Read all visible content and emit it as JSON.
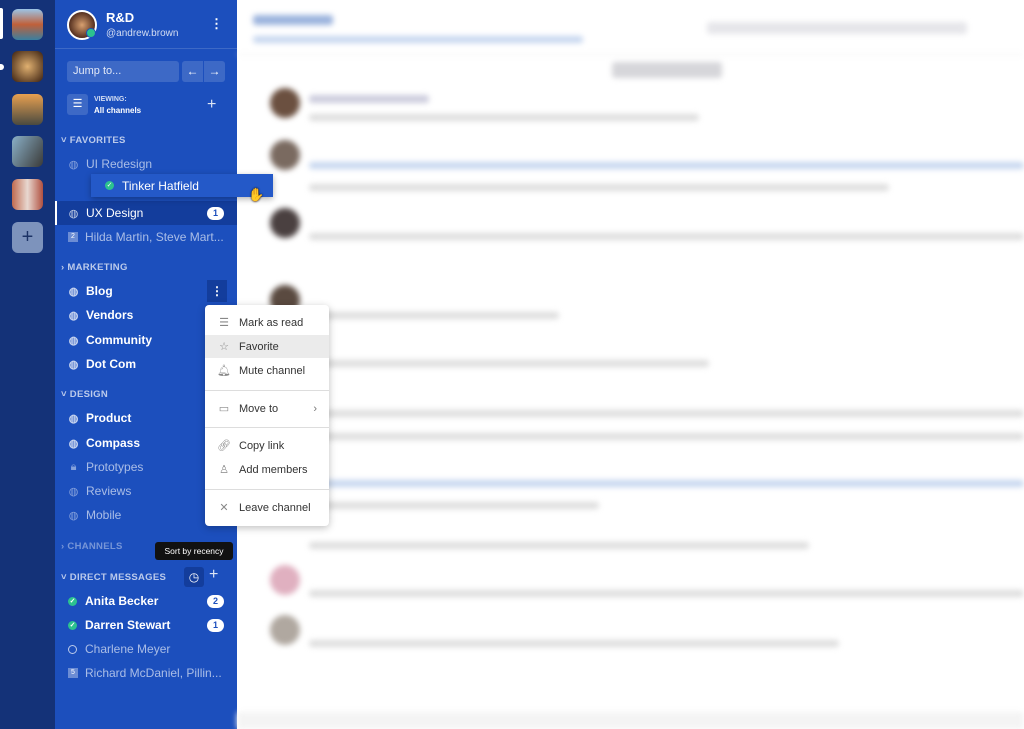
{
  "team_sidebar": {
    "teams": [
      "Golden Gate",
      "Cathedral",
      "City sunset",
      "Street",
      "Buildings"
    ],
    "add_label": "+"
  },
  "header": {
    "team_name": "R&D",
    "username": "@andrew.brown",
    "status": "online"
  },
  "jump": {
    "placeholder": "Jump to..."
  },
  "viewing": {
    "label": "VIEWING:",
    "value": "All channels"
  },
  "favorites": {
    "title": "FAVORITES",
    "items": [
      {
        "name": "UI Redesign"
      },
      {
        "name": "UX Design",
        "badge": "1",
        "active": true
      },
      {
        "name": "Hilda Martin, Steve Mart...",
        "count": "2"
      }
    ]
  },
  "drag_item": {
    "name": "Tinker Hatfield"
  },
  "marketing": {
    "title": "MARKETING",
    "items": [
      "Blog",
      "Vendors",
      "Community",
      "Dot Com"
    ]
  },
  "design": {
    "title": "DESIGN",
    "items": [
      {
        "name": "Product",
        "icon": "globe"
      },
      {
        "name": "Compass",
        "icon": "globe"
      },
      {
        "name": "Prototypes",
        "icon": "lock"
      },
      {
        "name": "Reviews",
        "icon": "globe"
      },
      {
        "name": "Mobile",
        "icon": "globe"
      }
    ]
  },
  "channels": {
    "title": "CHANNELS"
  },
  "tooltip": "Sort by recency",
  "direct_messages": {
    "title": "DIRECT MESSAGES",
    "items": [
      {
        "name": "Anita Becker",
        "badge": "2",
        "status": "online"
      },
      {
        "name": "Darren Stewart",
        "badge": "1",
        "status": "online"
      },
      {
        "name": "Charlene Meyer",
        "status": "offline"
      },
      {
        "name": "Richard McDaniel, Pillin...",
        "count": "5"
      }
    ]
  },
  "menu": {
    "items": [
      "Mark as read",
      "Favorite",
      "Mute channel",
      "Move to",
      "Copy link",
      "Add members",
      "Leave channel"
    ]
  },
  "colors": {
    "sidebar": "#1c4fbd",
    "team_sidebar": "#143278",
    "online": "#2cc28f"
  }
}
